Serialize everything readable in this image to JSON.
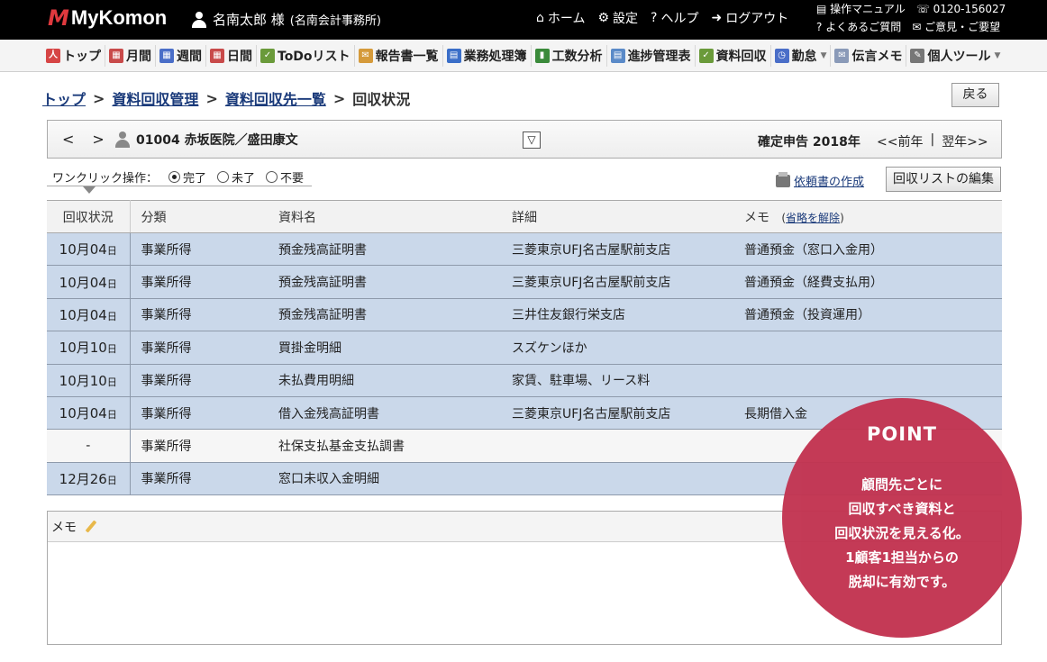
{
  "header": {
    "logo_mark": "M",
    "logo_text": "MyKomon",
    "user_name": "名南太郎 様",
    "user_office": "(名南会計事務所)",
    "nav": [
      {
        "icon": "home-icon",
        "label": "ホーム"
      },
      {
        "icon": "gear-icon",
        "label": "設定"
      },
      {
        "icon": "help-icon",
        "label": "ヘルプ"
      },
      {
        "icon": "logout-icon",
        "label": "ログアウト"
      }
    ],
    "manual_label": "操作マニュアル",
    "phone": "0120-156027",
    "faq_label": "よくあるご質問",
    "feedback_label": "ご意見・ご要望"
  },
  "menu": {
    "items": [
      {
        "label": "トップ",
        "color": "#d64545",
        "glyph": "人"
      },
      {
        "label": "月間",
        "color": "#c84a4a",
        "glyph": "▦"
      },
      {
        "label": "週間",
        "color": "#4a6ec8",
        "glyph": "▦"
      },
      {
        "label": "日間",
        "color": "#c84a4a",
        "glyph": "▦"
      },
      {
        "label": "ToDoリスト",
        "color": "#6a9a3a",
        "glyph": "✓"
      },
      {
        "label": "報告書一覧",
        "color": "#d59a3a",
        "glyph": "✉"
      },
      {
        "label": "業務処理簿",
        "color": "#3a6ec8",
        "glyph": "▤"
      },
      {
        "label": "工数分析",
        "color": "#3a8a3a",
        "glyph": "▮"
      },
      {
        "label": "進捗管理表",
        "color": "#5a8ac8",
        "glyph": "▤"
      },
      {
        "label": "資料回収",
        "color": "#6a9a3a",
        "glyph": "✓"
      },
      {
        "label": "勤怠",
        "color": "#4a6ec8",
        "glyph": "◷",
        "dropdown": true
      },
      {
        "label": "伝言メモ",
        "color": "#8a9ab8",
        "glyph": "✉"
      },
      {
        "label": "個人ツール",
        "color": "#777777",
        "glyph": "✎",
        "dropdown": true
      }
    ]
  },
  "breadcrumb": {
    "top": "トップ",
    "manage": "資料回収管理",
    "list": "資料回収先一覧",
    "current": "回収状況",
    "back": "戻る"
  },
  "client": {
    "prev_arrow": "<",
    "next_arrow": ">",
    "name": "01004 赤坂医院／盛田康文",
    "dropdown_glyph": "▽",
    "year_label": "確定申告 2018年",
    "prev_year": "<<前年",
    "divider": "|",
    "next_year": "翌年>>"
  },
  "oneclick": {
    "label": "ワンクリック操作：",
    "options": [
      {
        "label": "完了",
        "selected": true
      },
      {
        "label": "未了",
        "selected": false
      },
      {
        "label": "不要",
        "selected": false
      }
    ]
  },
  "actions": {
    "request_doc": "依頼書の作成",
    "edit_list": "回収リストの編集"
  },
  "table": {
    "headers": {
      "status": "回収状況",
      "category": "分類",
      "doc": "資料名",
      "detail": "詳細",
      "memo": "メモ",
      "memo_link_open": "(",
      "memo_link": "省略を解除",
      "memo_link_close": ")"
    },
    "day_unit": "日",
    "rows": [
      {
        "state": "done",
        "month": "10月",
        "day": "04",
        "category": "事業所得",
        "doc": "預金残高証明書",
        "detail": "三菱東京UFJ名古屋駅前支店",
        "memo": "普通預金（窓口入金用）"
      },
      {
        "state": "done",
        "month": "10月",
        "day": "04",
        "category": "事業所得",
        "doc": "預金残高証明書",
        "detail": "三菱東京UFJ名古屋駅前支店",
        "memo": "普通預金（経費支払用）"
      },
      {
        "state": "done",
        "month": "10月",
        "day": "04",
        "category": "事業所得",
        "doc": "預金残高証明書",
        "detail": "三井住友銀行栄支店",
        "memo": "普通預金（投資運用）"
      },
      {
        "state": "done",
        "month": "10月",
        "day": "10",
        "category": "事業所得",
        "doc": "買掛金明細",
        "detail": "スズケンほか",
        "memo": ""
      },
      {
        "state": "done",
        "month": "10月",
        "day": "10",
        "category": "事業所得",
        "doc": "未払費用明細",
        "detail": "家賃、駐車場、リース料",
        "memo": ""
      },
      {
        "state": "done",
        "month": "10月",
        "day": "04",
        "category": "事業所得",
        "doc": "借入金残高証明書",
        "detail": "三菱東京UFJ名古屋駅前支店",
        "memo": "長期借入金"
      },
      {
        "state": "pending",
        "status_text": "-",
        "category": "事業所得",
        "doc": "社保支払基金支払調書",
        "detail": "",
        "memo": ""
      },
      {
        "state": "done",
        "month": "12月",
        "day": "26",
        "category": "事業所得",
        "doc": "窓口未収入金明細",
        "detail": "",
        "memo": ""
      }
    ]
  },
  "memo_box": {
    "title": "メモ"
  },
  "point": {
    "title": "POINT",
    "lines": [
      "顧問先ごとに",
      "回収すべき資料と",
      "回収状況を見える化。",
      "1顧客1担当からの",
      "脱却に有効です。"
    ]
  }
}
